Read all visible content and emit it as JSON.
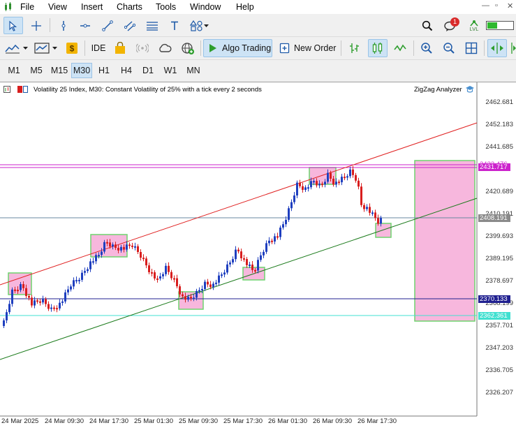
{
  "menu": {
    "items": [
      "File",
      "View",
      "Insert",
      "Charts",
      "Tools",
      "Window",
      "Help"
    ],
    "window_controls": [
      "—",
      "▫",
      "✕"
    ]
  },
  "toolbar1": {
    "tools": [
      "cursor-icon",
      "crosshair-icon",
      "vertical-line-icon",
      "horizontal-line-icon",
      "trendline-icon",
      "equidistant-channel-icon",
      "fibonacci-icon",
      "text-icon",
      "shapes-icon"
    ],
    "notification_count": "1",
    "signal_label": "LVL"
  },
  "toolbar2": {
    "ide_label": "IDE",
    "algo_trading_label": "Algo Trading",
    "new_order_label": "New Order"
  },
  "timeframes": {
    "items": [
      "M1",
      "M5",
      "M15",
      "M30",
      "H1",
      "H4",
      "D1",
      "W1",
      "MN"
    ],
    "active": "M30"
  },
  "chart": {
    "title": "Volatility 25 Index, M30:  Constant Volatility of 25% with a tick every 2 seconds",
    "indicator": "ZigZag Analyzer",
    "price_labels": [
      "2462.681",
      "2452.183",
      "2441.685",
      "2420.689",
      "2410.191",
      "2399.693",
      "2389.195",
      "2378.697",
      "2368.199",
      "2357.701",
      "2347.203",
      "2336.705",
      "2326.207"
    ],
    "time_labels": [
      "24 Mar 2025",
      "24 Mar 09:30",
      "24 Mar 17:30",
      "25 Mar 01:30",
      "25 Mar 09:30",
      "25 Mar 17:30",
      "26 Mar 01:30",
      "26 Mar 09:30",
      "26 Mar 17:30"
    ],
    "tags": {
      "magenta_level": "2431.717",
      "current_price": "2408.191",
      "blue_level": "2370.133",
      "cyan_level": "2362.361",
      "magenta_level_2": "2433.476"
    },
    "colors": {
      "bull": "#1f3fbf",
      "bear": "#d81e1e",
      "channel_upper": "#e02020",
      "channel_lower": "#1a7a1a",
      "magenta": "#cc22cc",
      "blue_line": "#202090",
      "cyan_line": "#40e0d0",
      "zone_fill": "#f7b7dd",
      "zone_border": "#6fd46f"
    }
  }
}
